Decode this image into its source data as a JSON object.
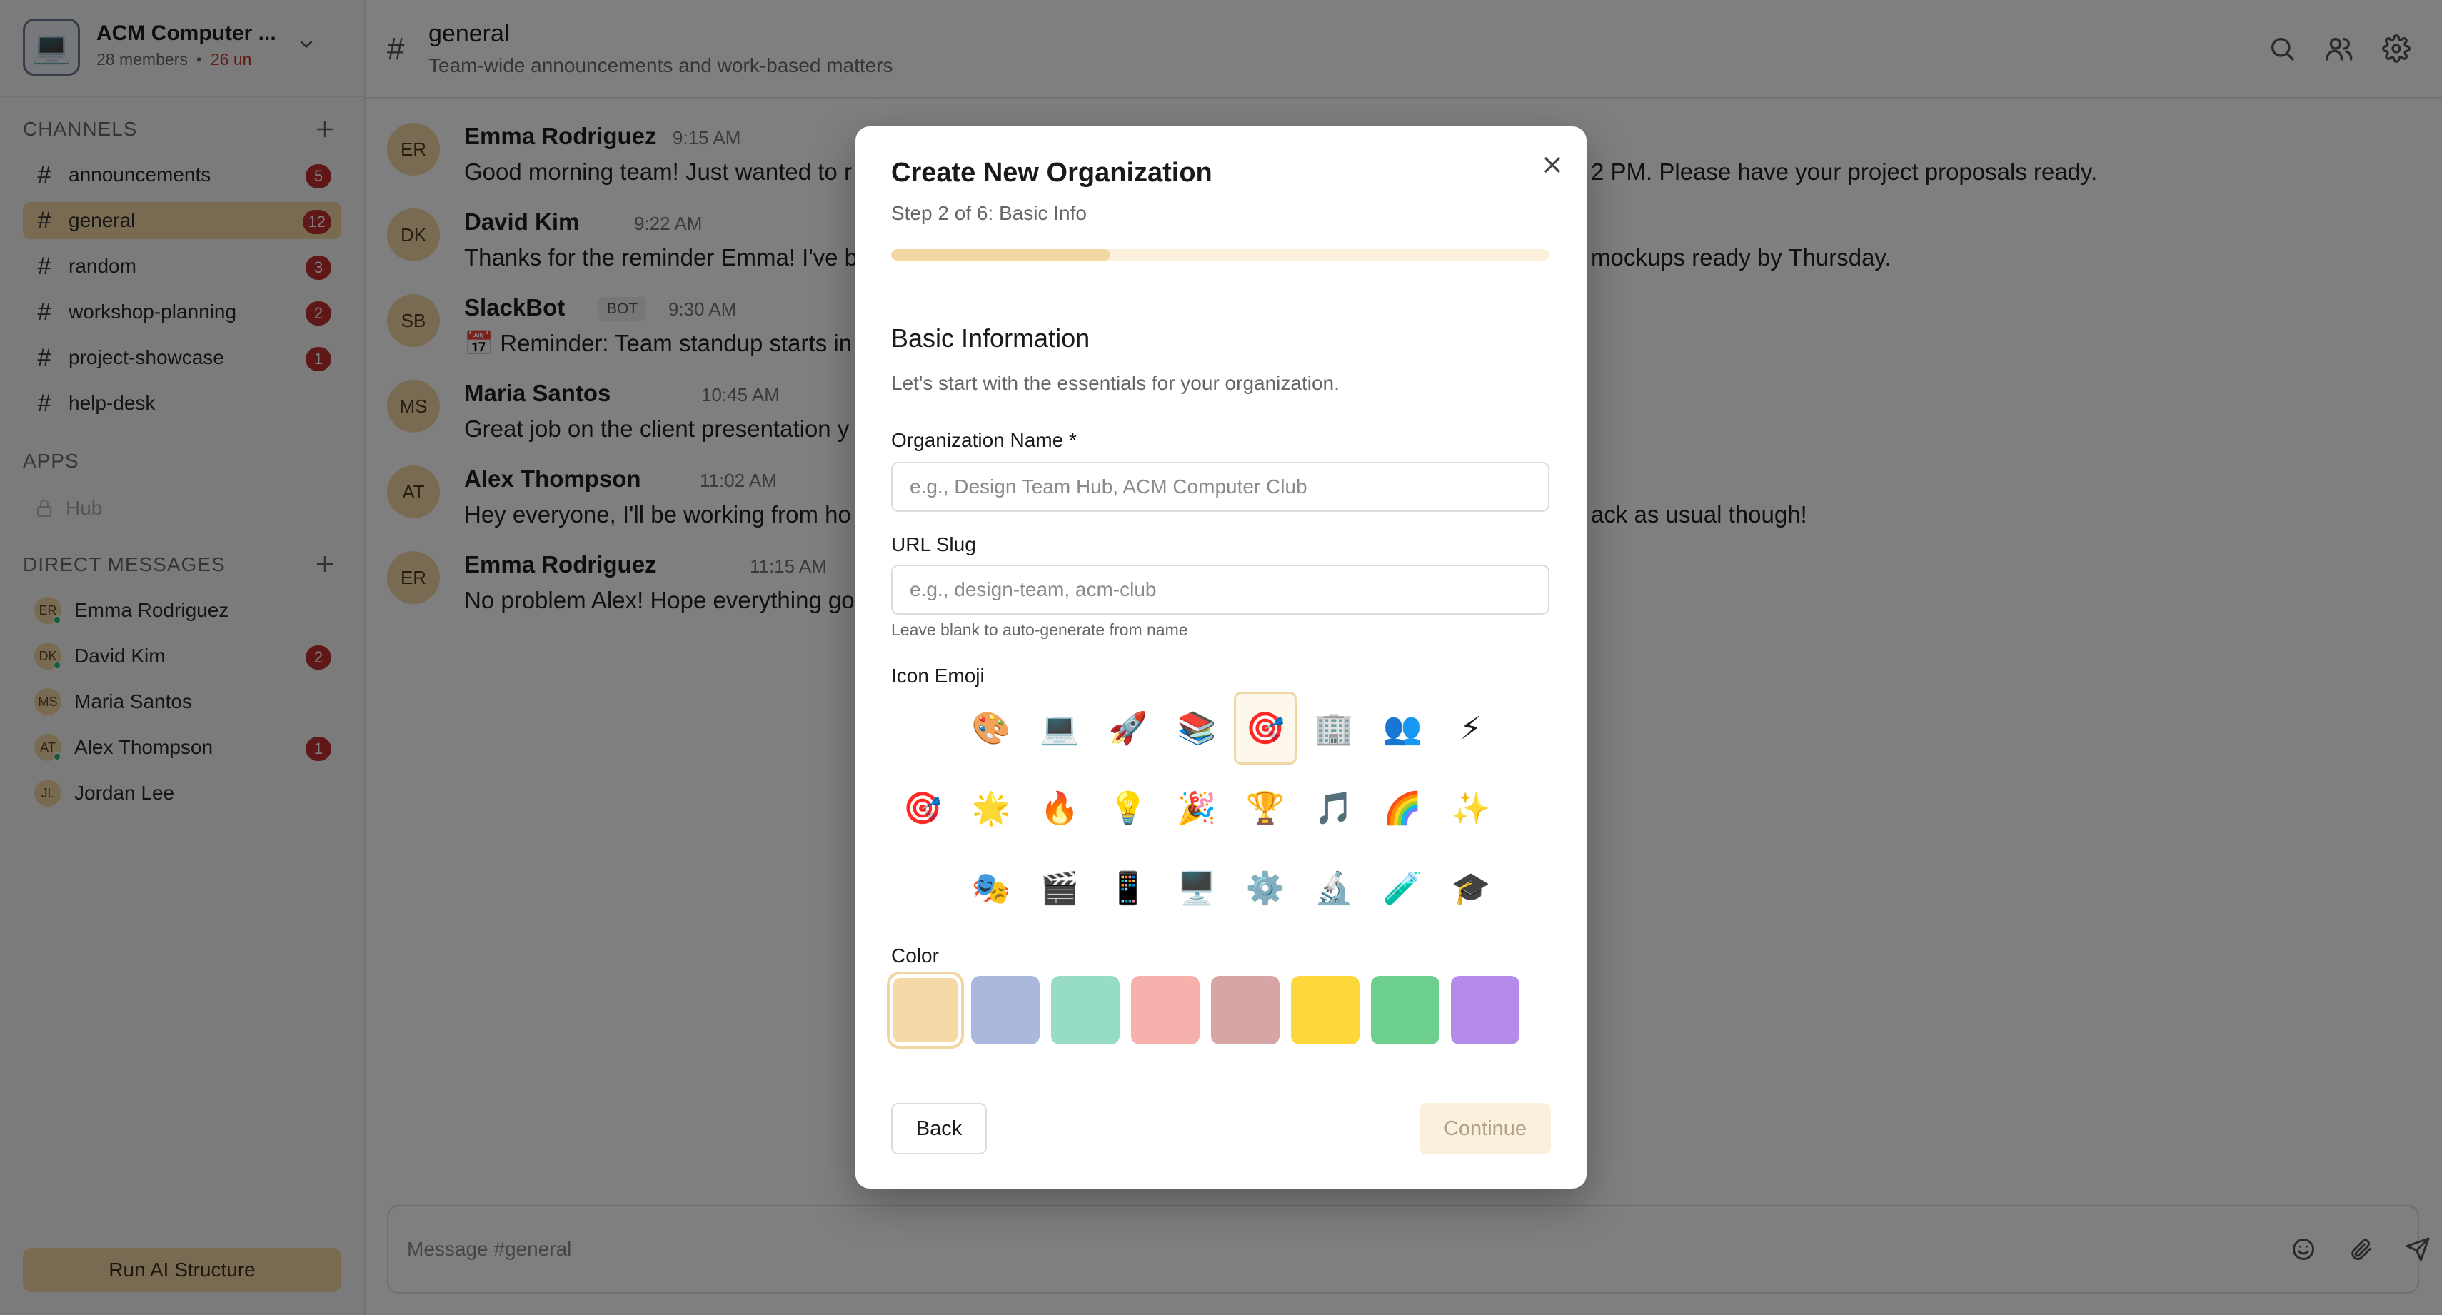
{
  "workspace": {
    "icon": "💻",
    "name": "ACM Computer ...",
    "members": "28 members",
    "unread": "26 un"
  },
  "sidebar": {
    "channels_title": "CHANNELS",
    "channels": [
      {
        "name": "announcements",
        "badge": "5"
      },
      {
        "name": "general",
        "badge": "12",
        "active": true
      },
      {
        "name": "random",
        "badge": "3"
      },
      {
        "name": "workshop-planning",
        "badge": "2"
      },
      {
        "name": "project-showcase",
        "badge": "1"
      },
      {
        "name": "help-desk",
        "badge": ""
      }
    ],
    "apps_title": "APPS",
    "apps": [
      {
        "name": "Hub"
      }
    ],
    "dms_title": "DIRECT MESSAGES",
    "dms": [
      {
        "initials": "ER",
        "name": "Emma Rodriguez",
        "badge": "",
        "online": true
      },
      {
        "initials": "DK",
        "name": "David Kim",
        "badge": "2",
        "online": true
      },
      {
        "initials": "MS",
        "name": "Maria Santos",
        "badge": "",
        "online": false
      },
      {
        "initials": "AT",
        "name": "Alex Thompson",
        "badge": "1",
        "online": true
      },
      {
        "initials": "JL",
        "name": "Jordan Lee",
        "badge": "",
        "online": false
      }
    ],
    "run_ai_label": "Run AI Structure"
  },
  "channel": {
    "hash": "#",
    "title": "general",
    "description": "Team-wide announcements and work-based matters"
  },
  "messages": [
    {
      "initials": "ER",
      "author": "Emma Rodriguez",
      "time": "9:15 AM",
      "text": "Good morning team! Just wanted to r",
      "tail": "2 PM. Please have your project proposals ready."
    },
    {
      "initials": "DK",
      "author": "David Kim",
      "time": "9:22 AM",
      "text": "Thanks for the reminder Emma! I've b",
      "tail": "mockups ready by Thursday."
    },
    {
      "initials": "SB",
      "author": "SlackBot",
      "bot": "BOT",
      "time": "9:30 AM",
      "text": "📅 Reminder: Team standup starts in",
      "tail": ""
    },
    {
      "initials": "MS",
      "author": "Maria Santos",
      "time": "10:45 AM",
      "text": "Great job on the client presentation y",
      "tail": ""
    },
    {
      "initials": "AT",
      "author": "Alex Thompson",
      "time": "11:02 AM",
      "text": "Hey everyone, I'll be working from ho",
      "tail": "ack as usual though!"
    },
    {
      "initials": "ER",
      "author": "Emma Rodriguez",
      "time": "11:15 AM",
      "text": "No problem Alex! Hope everything go",
      "tail": ""
    }
  ],
  "composer": {
    "placeholder": "Message #general"
  },
  "modal": {
    "title": "Create New Organization",
    "step": "Step 2 of 6: Basic Info",
    "progress": 0.3333,
    "section_title": "Basic Information",
    "section_sub": "Let's start with the essentials for your organization.",
    "org_name_label": "Organization Name *",
    "org_name_placeholder": "e.g., Design Team Hub, ACM Computer Club",
    "org_name_value": "",
    "slug_label": "URL Slug",
    "slug_placeholder": "e.g., design-team, acm-club",
    "slug_value": "",
    "slug_hint": "Leave blank to auto-generate from name",
    "emoji_label": "Icon Emoji",
    "emoji_rows": [
      [
        "",
        "🎨",
        "💻",
        "🚀",
        "📚",
        "🎯",
        "🏢",
        "👥",
        "⚡"
      ],
      [
        "🎯",
        "🌟",
        "🔥",
        "💡",
        "🎉",
        "🏆",
        "🎵",
        "🌈",
        "✨"
      ],
      [
        "",
        "🎭",
        "🎬",
        "📱",
        "🖥️",
        "⚙️",
        "🔬",
        "🧪",
        "🎓"
      ]
    ],
    "selected_emoji": "🎯",
    "color_label": "Color",
    "colors": [
      "#f5d9a6",
      "#aab8dd",
      "#97dcc6",
      "#f6b1ac",
      "#d6a5a5",
      "#fdd83a",
      "#6dd08e",
      "#b58bea"
    ],
    "selected_color": "#f5d9a6",
    "back_label": "Back",
    "continue_label": "Continue"
  }
}
